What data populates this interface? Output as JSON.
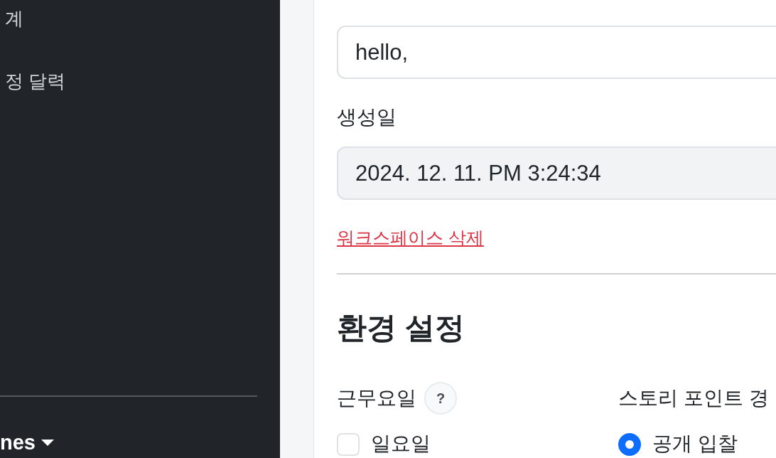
{
  "sidebar": {
    "items": [
      {
        "label": "계"
      },
      {
        "label": "정 달력"
      }
    ],
    "user_menu": {
      "label": "nes"
    }
  },
  "workspace_form": {
    "fields": [
      {
        "value": "hello,",
        "readonly": false
      },
      {
        "label": "생성일",
        "value": "2024. 12. 11. PM 3:24:34",
        "readonly": true
      }
    ],
    "delete_link": "워크스페이스 삭제"
  },
  "preferences": {
    "title": "환경 설정",
    "groups": [
      {
        "label": "근무요일",
        "help": "?",
        "kind": "checkbox",
        "options": [
          {
            "label": "일요일",
            "checked": false
          }
        ]
      },
      {
        "label": "스토리 포인트 경",
        "kind": "radio",
        "options": [
          {
            "label": "공개 입찰",
            "selected": true
          }
        ]
      }
    ]
  }
}
